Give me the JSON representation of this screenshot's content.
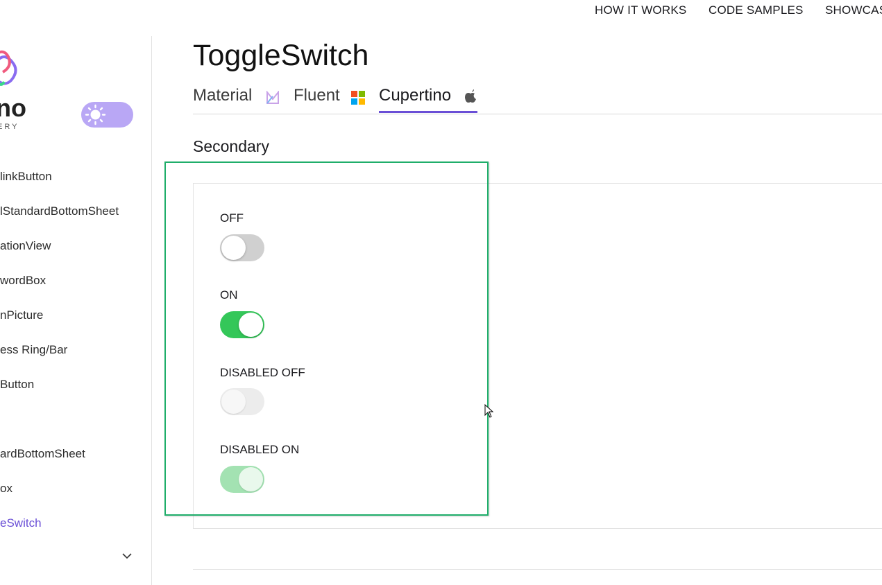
{
  "topnav": {
    "links": [
      "HOW IT WORKS",
      "CODE SAMPLES",
      "SHOWCAS"
    ]
  },
  "sidebar": {
    "logo_text": "no",
    "logo_subtext": "ERY",
    "theme_toggle_icon": "sun-icon",
    "items": [
      "linkButton",
      "lStandardBottomSheet",
      "ationView",
      "wordBox",
      "nPicture",
      "ess Ring/Bar",
      "Button",
      "ardBottomSheet",
      "ox",
      "eSwitch"
    ],
    "active_item": "eSwitch",
    "expand_icon": "chevron-down-icon"
  },
  "page": {
    "title": "ToggleSwitch",
    "tabs": [
      {
        "label": "Material",
        "icon": "material-icon"
      },
      {
        "label": "Fluent",
        "icon": "windows-icon"
      },
      {
        "label": "Cupertino",
        "icon": "apple-icon"
      }
    ],
    "active_tab": "Cupertino",
    "section_title": "Secondary",
    "switches": [
      {
        "label": "OFF",
        "state": "off",
        "enabled": true
      },
      {
        "label": "ON",
        "state": "on",
        "enabled": true
      },
      {
        "label": "DISABLED OFF",
        "state": "off",
        "enabled": false
      },
      {
        "label": "DISABLED ON",
        "state": "on",
        "enabled": false
      }
    ]
  },
  "colors": {
    "accent": "#6a4fd6",
    "switch_on": "#34c759",
    "switch_off": "#d0d0d0",
    "highlight_border": "#1fae6a",
    "theme_toggle": "#b9a7f5"
  }
}
